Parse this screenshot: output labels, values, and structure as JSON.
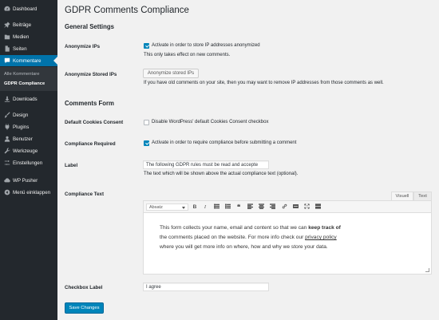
{
  "sidebar": {
    "items": [
      {
        "label": "Dashboard",
        "icon": "dashboard-icon"
      },
      {
        "label": "Beiträge",
        "icon": "pin-icon"
      },
      {
        "label": "Medien",
        "icon": "media-icon"
      },
      {
        "label": "Seiten",
        "icon": "page-icon"
      },
      {
        "label": "Kommentare",
        "icon": "comment-icon",
        "active": true
      },
      {
        "label": "Downloads",
        "icon": "download-icon"
      },
      {
        "label": "Design",
        "icon": "brush-icon"
      },
      {
        "label": "Plugins",
        "icon": "plugin-icon"
      },
      {
        "label": "Benutzer",
        "icon": "user-icon"
      },
      {
        "label": "Werkzeuge",
        "icon": "wrench-icon"
      },
      {
        "label": "Einstellungen",
        "icon": "settings-icon"
      },
      {
        "label": "WP Pusher",
        "icon": "cloud-icon"
      },
      {
        "label": "Menü einklappen",
        "icon": "collapse-icon"
      }
    ],
    "submenu": [
      {
        "label": "Alle Kommentare"
      },
      {
        "label": "GDPR Compliance",
        "current": true
      }
    ]
  },
  "page": {
    "title": "GDPR Comments Compliance",
    "general_settings": "General Settings",
    "anonymize_ips": {
      "label": "Anonymize IPs",
      "checkbox_label": "Activate in order to store IP addresses anonymized",
      "checked": true,
      "description": "This only takes effect on new comments."
    },
    "anonymize_stored": {
      "label": "Anonymize Stored IPs",
      "button": "Anonymize stored IPs",
      "description": "If you have old comments on your site, then you may want to remove IP addresses from those comments as well."
    },
    "comments_form": "Comments Form",
    "default_cookies": {
      "label": "Default Cookies Consent",
      "checkbox_label": "Disable WordPress' default Cookies Consent checkbox",
      "checked": false
    },
    "compliance_required": {
      "label": "Compliance Required",
      "checkbox_label": "Activate in order to require compliance before submitting a comment",
      "checked": true
    },
    "label_field": {
      "label": "Label",
      "value": "The following GDPR rules must be read and accepte",
      "description": "The text which will be shown above the actual compliance text (optional)."
    },
    "compliance_text": {
      "label": "Compliance Text",
      "tab_visual": "Visuell",
      "tab_text": "Text",
      "format_select": "Absatz",
      "line1_pre": "This form collects your name, email and content so that we can ",
      "line1_bold": "keep track of",
      "line2_pre": "the comments placed on the website. For more info check our ",
      "line2_link": "privacy policy",
      "line3": "where you will get more info on where, how and why we store your data."
    },
    "checkbox_label": {
      "label": "Checkbox Label",
      "value": "I agree"
    },
    "save_button": "Save Changes"
  },
  "colors": {
    "sidebar_bg": "#23282d",
    "accent": "#0073aa",
    "primary_button": "#0085ba",
    "page_bg": "#f1f1f1"
  }
}
